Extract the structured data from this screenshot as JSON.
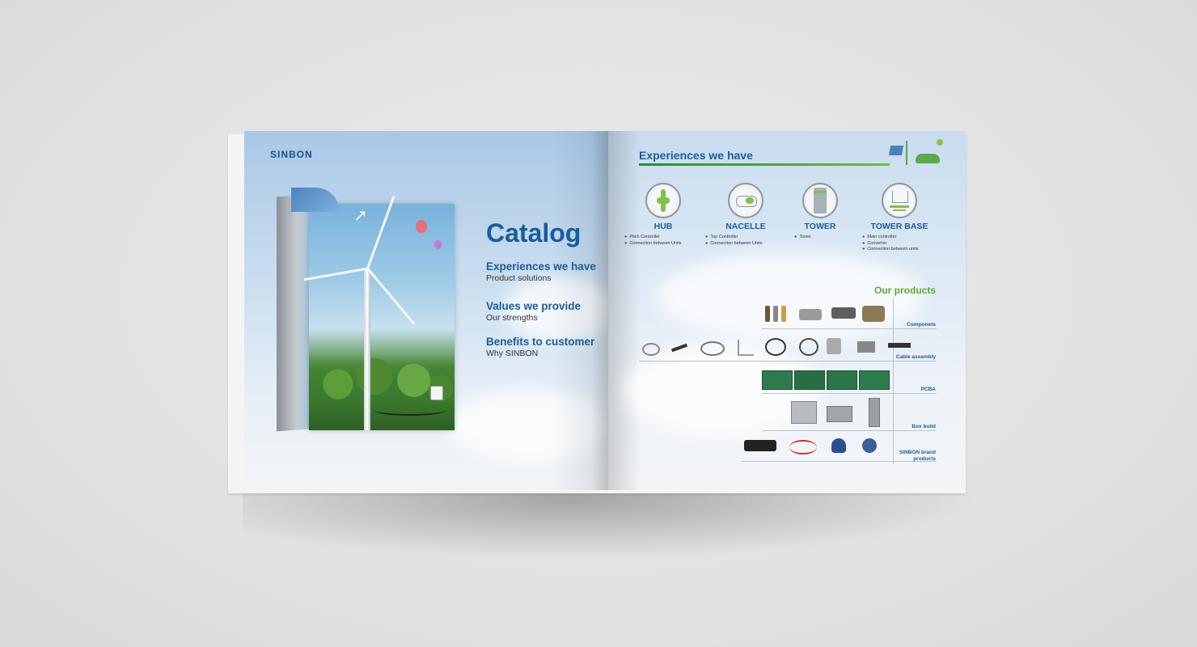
{
  "left_page": {
    "logo": "SINBON",
    "title": "Catalog",
    "toc": [
      {
        "heading": "Experiences we have",
        "sub": "Product solutions"
      },
      {
        "heading": "Values we provide",
        "sub": "Our strengths"
      },
      {
        "heading": "Benefits to customer",
        "sub": "Why SINBON"
      }
    ]
  },
  "right_page": {
    "title": "Experiences we have",
    "categories": [
      {
        "name": "HUB",
        "items": [
          "Pitch Controller",
          "Connection between Units"
        ]
      },
      {
        "name": "NACELLE",
        "items": [
          "Top Controller",
          "Connection between Units"
        ]
      },
      {
        "name": "TOWER",
        "items": [
          "Tower"
        ]
      },
      {
        "name": "TOWER BASE",
        "items": [
          "Main controller",
          "Converter",
          "Connection between units"
        ]
      }
    ],
    "products_title": "Our products",
    "products": [
      {
        "label": "Componets"
      },
      {
        "label": "Cable assembly"
      },
      {
        "label": "PCBA"
      },
      {
        "label": "Box build"
      },
      {
        "label": "SINBON brand products"
      }
    ]
  },
  "colors": {
    "brand_blue": "#1a5c9c",
    "accent_green": "#5aab2f",
    "background": "#e2e2e2"
  }
}
